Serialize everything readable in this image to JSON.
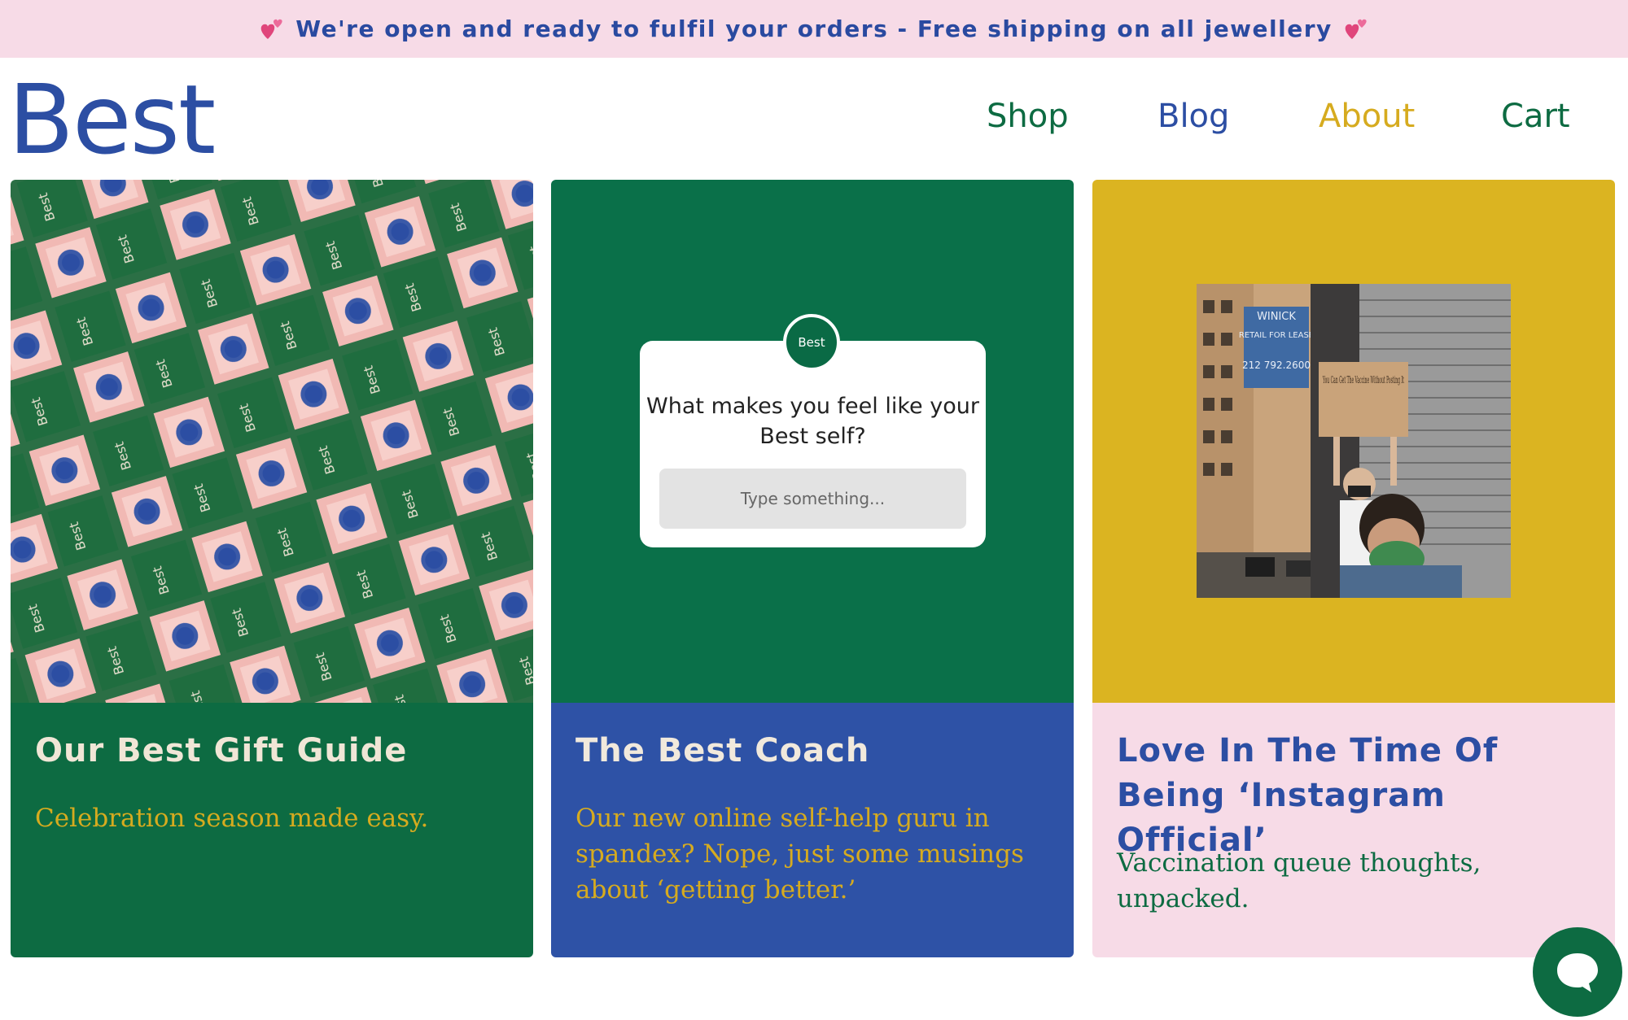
{
  "banner": {
    "text": "We're open and ready to fulfil your orders - Free shipping on all jewellery"
  },
  "header": {
    "logo": "Best",
    "nav": [
      {
        "label": "Shop",
        "color": "#0d6b42"
      },
      {
        "label": "Blog",
        "color": "#2c4ea3"
      },
      {
        "label": "About",
        "color": "#d6ab1f"
      },
      {
        "label": "Cart",
        "color": "#0d6b42"
      }
    ]
  },
  "cards": [
    {
      "title": "Our Best Gift Guide",
      "subtitle": "Celebration season made easy.",
      "image_box_label": "Best",
      "colors": {
        "body": "#0d6b42",
        "title": "#f0e6d6",
        "subtitle": "#d6ab1f"
      }
    },
    {
      "title": "The Best Coach",
      "subtitle": "Our new online self-help guru in spandex? Nope, just some musings about ‘getting better.’",
      "poll": {
        "avatar_label": "Best",
        "question": "What makes you feel like your Best self?",
        "placeholder": "Type something..."
      },
      "colors": {
        "image_bg": "#0a7049",
        "body": "#2e52a6",
        "title": "#f1e9dc",
        "subtitle": "#d6ab1f"
      }
    },
    {
      "title": "Love In The Time Of Being ‘Instagram Official’",
      "subtitle": "Vaccination queue thoughts, unpacked.",
      "photo": {
        "building_sign": "WINICK",
        "lease_sign": "RETAIL FOR LEASE",
        "lease_number": "212 792.2600",
        "protest_sign": "You Can Get The Vaccine Without Posting It"
      },
      "colors": {
        "image_bg": "#dbb421",
        "body": "#f7dbe7",
        "title": "#2c4ea3",
        "subtitle": "#0d6b42"
      }
    }
  ],
  "chat": {
    "icon": "chat-bubble-icon"
  }
}
